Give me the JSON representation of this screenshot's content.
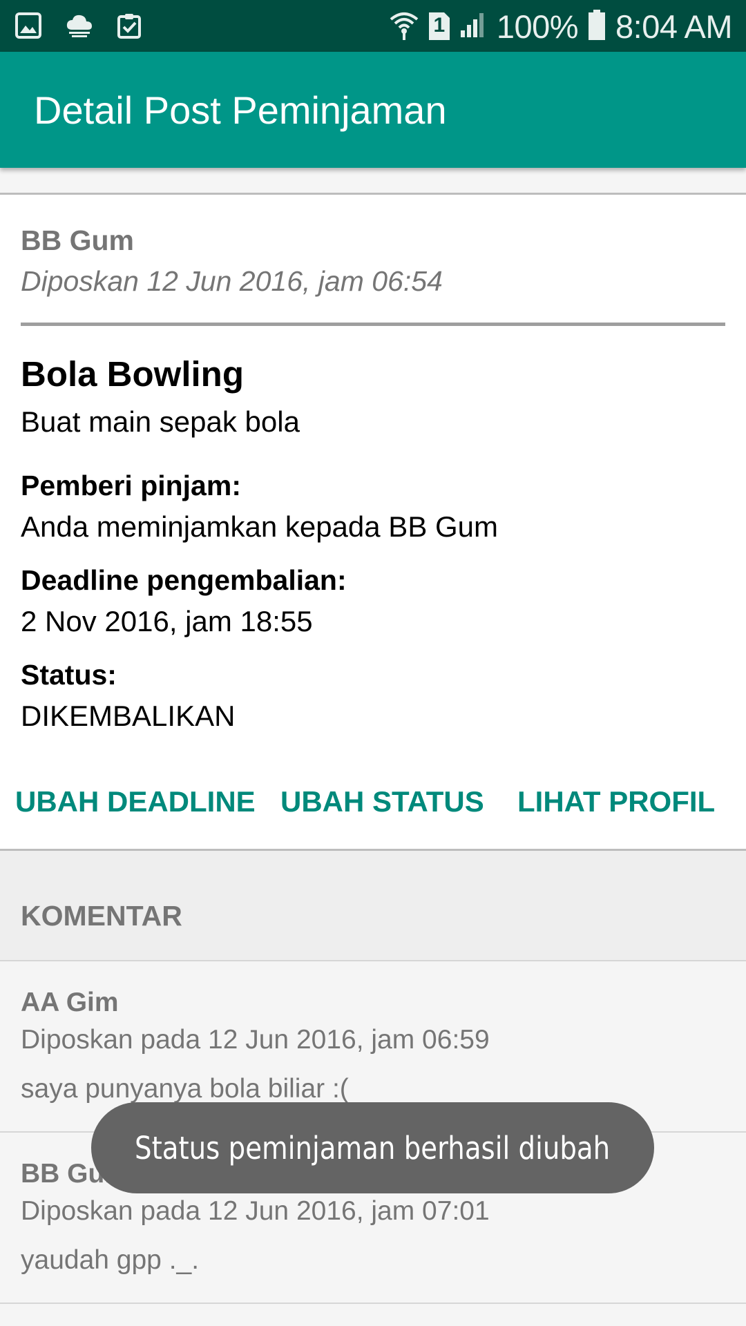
{
  "status_bar": {
    "battery": "100%",
    "time": "8:04 AM",
    "sim": "1",
    "icons": [
      "gallery-icon",
      "cloud-icon",
      "clipboard-check-icon",
      "wifi-icon",
      "sim-icon",
      "signal-icon",
      "battery-icon"
    ]
  },
  "app_bar": {
    "title": "Detail Post Peminjaman"
  },
  "post": {
    "author": "BB Gum",
    "posted": "Diposkan 12 Jun 2016, jam 06:54",
    "item_title": "Bola Bowling",
    "item_desc": "Buat main sepak bola",
    "lender_label": "Pemberi pinjam:",
    "lender_value": "Anda meminjamkan kepada BB Gum",
    "deadline_label": "Deadline pengembalian:",
    "deadline_value": "2 Nov 2016, jam 18:55",
    "status_label": "Status:",
    "status_value": "DIKEMBALIKAN",
    "actions": {
      "change_deadline": "UBAH DEADLINE",
      "change_status": "UBAH STATUS",
      "view_profile": "LIHAT PROFIL"
    }
  },
  "comments": {
    "header": "KOMENTAR",
    "items": [
      {
        "author": "AA Gim",
        "date": "Diposkan pada 12 Jun 2016, jam 06:59",
        "text": "saya punyanya bola biliar :("
      },
      {
        "author": "BB Gum",
        "date": "Diposkan pada 12 Jun 2016, jam 07:01",
        "text": "yaudah gpp ._."
      }
    ]
  },
  "toast": {
    "message": "Status peminjaman berhasil diubah"
  },
  "colors": {
    "status_bar": "#004d40",
    "app_bar": "#009688",
    "accent": "#00897b",
    "toast": "#646464"
  }
}
